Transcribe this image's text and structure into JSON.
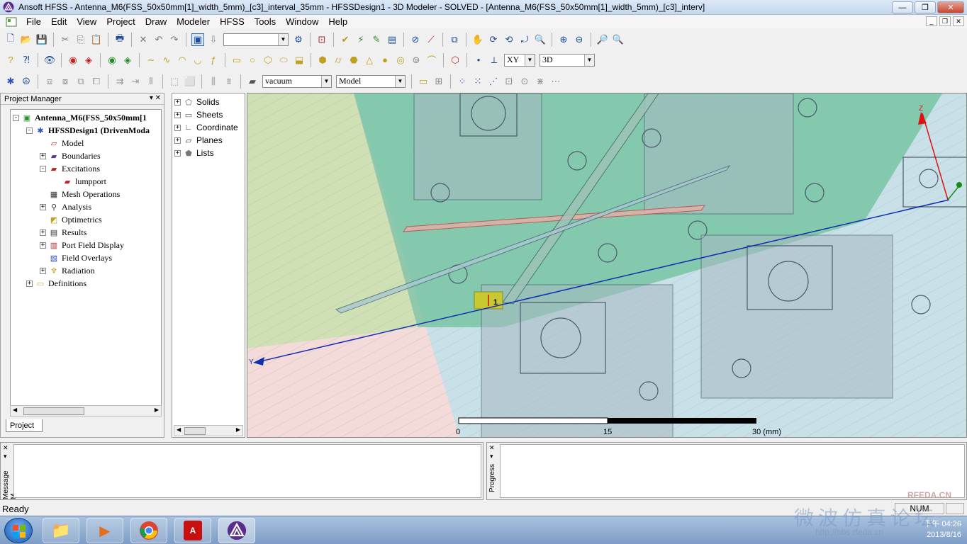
{
  "window": {
    "title": "Ansoft HFSS  - Antenna_M6(FSS_50x50mm[1]_width_5mm)_[c3]_interval_35mm - HFSSDesign1 - 3D Modeler - SOLVED - [Antenna_M6(FSS_50x50mm[1]_width_5mm)_[c3]_interv]",
    "minimize": "—",
    "maximize": "❐",
    "close": "✕"
  },
  "menu": [
    "File",
    "Edit",
    "View",
    "Project",
    "Draw",
    "Modeler",
    "HFSS",
    "Tools",
    "Window",
    "Help"
  ],
  "toolbar": {
    "plane_select": "XY",
    "view_mode": "3D",
    "material": "vacuum",
    "model_type": "Model",
    "empty_combo": ""
  },
  "project_manager": {
    "header": "Project Manager",
    "tab": "Project",
    "tree": [
      {
        "label": "Antenna_M6(FSS_50x50mm[1",
        "indent": 0,
        "expander": "-",
        "icon": "project-icon",
        "bold": true
      },
      {
        "label": "HFSSDesign1 (DrivenModa",
        "indent": 1,
        "expander": "-",
        "icon": "design-icon",
        "bold": true
      },
      {
        "label": "Model",
        "indent": 2,
        "expander": "",
        "icon": "model-icon",
        "bold": false
      },
      {
        "label": "Boundaries",
        "indent": 2,
        "expander": "+",
        "icon": "boundaries-icon",
        "bold": false
      },
      {
        "label": "Excitations",
        "indent": 2,
        "expander": "-",
        "icon": "excitations-icon",
        "bold": false
      },
      {
        "label": "lumpport",
        "indent": 3,
        "expander": "",
        "icon": "lumpport-icon",
        "bold": false
      },
      {
        "label": "Mesh Operations",
        "indent": 2,
        "expander": "",
        "icon": "mesh-icon",
        "bold": false
      },
      {
        "label": "Analysis",
        "indent": 2,
        "expander": "+",
        "icon": "analysis-icon",
        "bold": false
      },
      {
        "label": "Optimetrics",
        "indent": 2,
        "expander": "",
        "icon": "optimetrics-icon",
        "bold": false
      },
      {
        "label": "Results",
        "indent": 2,
        "expander": "+",
        "icon": "results-icon",
        "bold": false
      },
      {
        "label": "Port Field Display",
        "indent": 2,
        "expander": "+",
        "icon": "port-field-icon",
        "bold": false
      },
      {
        "label": "Field Overlays",
        "indent": 2,
        "expander": "",
        "icon": "field-overlays-icon",
        "bold": false
      },
      {
        "label": "Radiation",
        "indent": 2,
        "expander": "+",
        "icon": "radiation-icon",
        "bold": false
      },
      {
        "label": "Definitions",
        "indent": 1,
        "expander": "+",
        "icon": "folder-icon",
        "bold": false
      }
    ]
  },
  "model_tree": [
    {
      "label": "Solids",
      "icon": "solids-icon"
    },
    {
      "label": "Sheets",
      "icon": "sheets-icon"
    },
    {
      "label": "Coordinate",
      "icon": "coordinate-icon"
    },
    {
      "label": "Planes",
      "icon": "planes-icon"
    },
    {
      "label": "Lists",
      "icon": "lists-icon"
    }
  ],
  "viewport": {
    "scale_labels": [
      "0",
      "15",
      "30 (mm)"
    ],
    "axis_z": "Z",
    "axis_y": "Y",
    "port_label": "1",
    "colors": {
      "substrate": "#4db38a",
      "ground_pink": "#f5d0d0",
      "fss_blue": "#b9dce0",
      "feed_red": "#c84040",
      "axis_red": "#e01010",
      "axis_blue": "#1030b0"
    }
  },
  "panels": {
    "message": "Message M...",
    "progress": "Progress"
  },
  "status": {
    "ready": "Ready",
    "num": "NUM"
  },
  "taskbar": {
    "time": "下午 04:26",
    "date": "2013/8/16",
    "watermark_cn": "微波仿真论坛",
    "watermark_site": "RFEDA.CN",
    "watermark_url": "http://bbs.rfeda.cn"
  }
}
